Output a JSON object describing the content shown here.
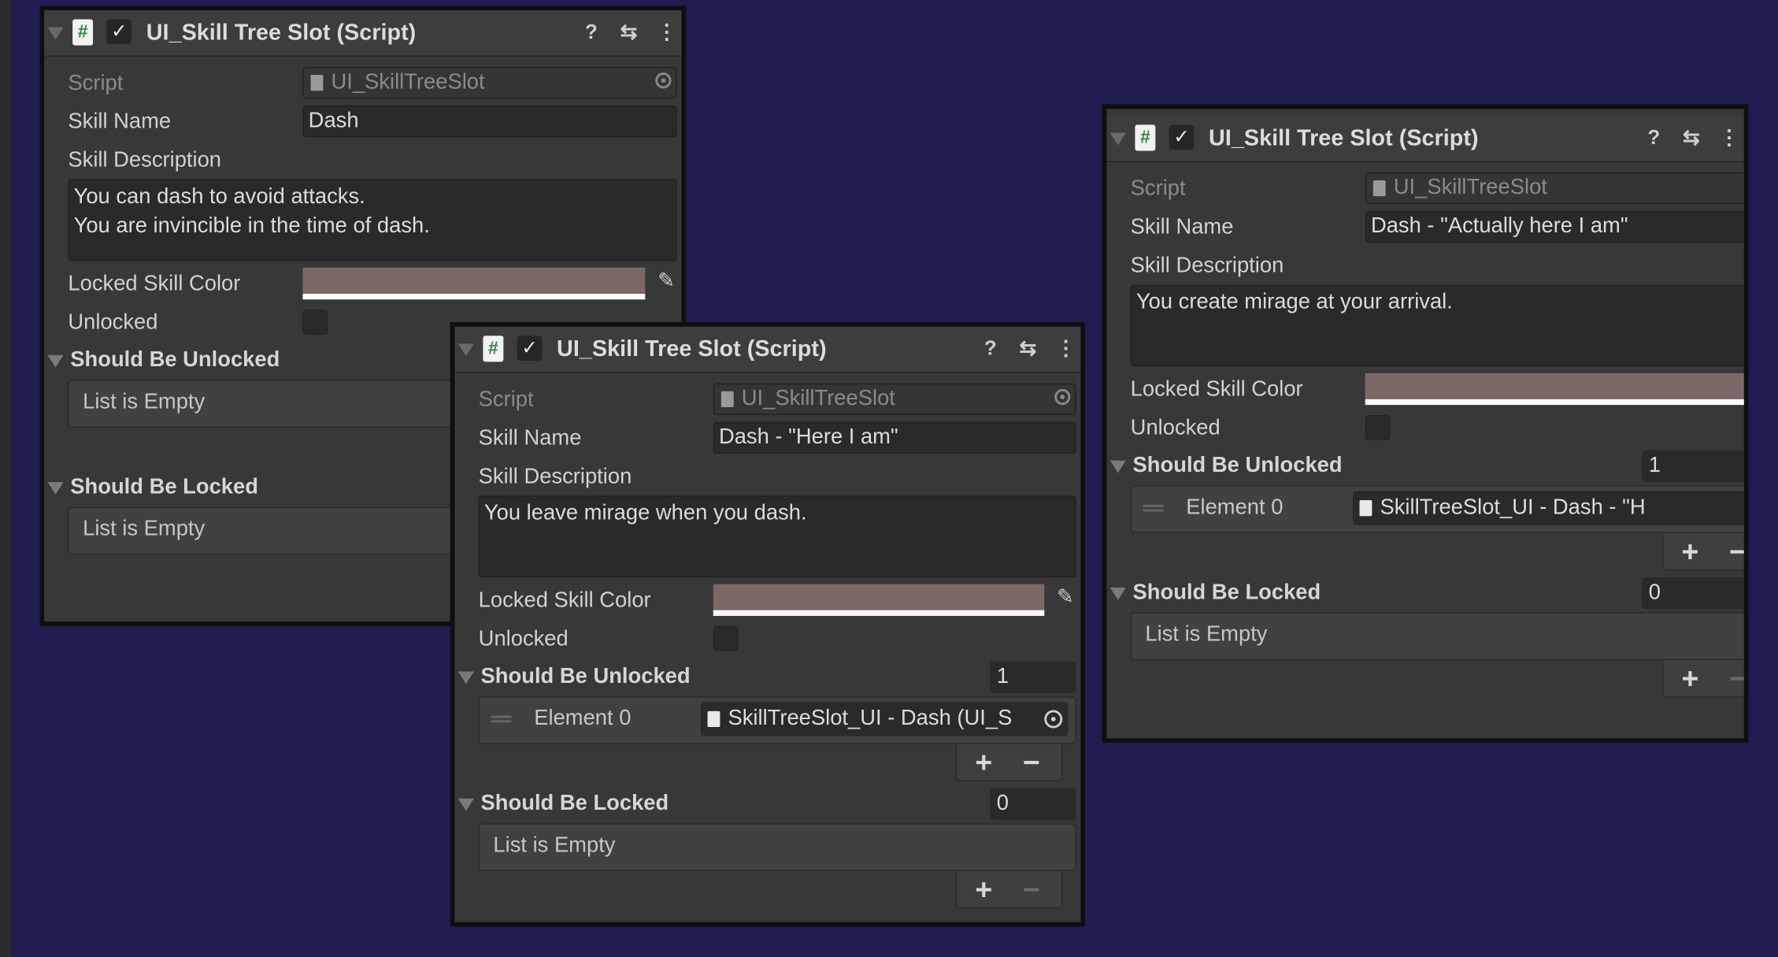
{
  "panels": [
    {
      "title": "UI_Skill Tree Slot (Script)",
      "enabled": "✓",
      "script_label": "Script",
      "script_value": "UI_SkillTreeSlot",
      "skill_name_label": "Skill Name",
      "skill_name_value": "Dash",
      "skill_description_label": "Skill Description",
      "skill_description_value": "You can dash to avoid attacks.\nYou are invincible in the time of dash.",
      "locked_color_label": "Locked Skill Color",
      "locked_color": "#7d6868",
      "unlocked_label": "Unlocked",
      "unlocked": false,
      "should_be_unlocked": {
        "label": "Should Be Unlocked",
        "empty_text": "List is Empty"
      },
      "should_be_locked": {
        "label": "Should Be Locked",
        "empty_text": "List is Empty"
      }
    },
    {
      "title": "UI_Skill Tree Slot (Script)",
      "enabled": "✓",
      "script_label": "Script",
      "script_value": "UI_SkillTreeSlot",
      "skill_name_label": "Skill Name",
      "skill_name_value": "Dash - \"Here I am\"",
      "skill_description_label": "Skill Description",
      "skill_description_value": "You leave mirage when you dash.",
      "locked_color_label": "Locked Skill Color",
      "locked_color": "#7d6868",
      "unlocked_label": "Unlocked",
      "unlocked": false,
      "should_be_unlocked": {
        "label": "Should Be Unlocked",
        "count": "1",
        "elements": [
          {
            "label": "Element 0",
            "value": "SkillTreeSlot_UI - Dash (UI_S"
          }
        ],
        "add": "+",
        "remove": "−"
      },
      "should_be_locked": {
        "label": "Should Be Locked",
        "count": "0",
        "empty_text": "List is Empty",
        "add": "+",
        "remove": "−"
      }
    },
    {
      "title": "UI_Skill Tree Slot (Script)",
      "enabled": "✓",
      "script_label": "Script",
      "script_value": "UI_SkillTreeSlot",
      "skill_name_label": "Skill Name",
      "skill_name_value": "Dash - \"Actually here I am\"",
      "skill_description_label": "Skill Description",
      "skill_description_value": "You create mirage at your arrival.",
      "locked_color_label": "Locked Skill Color",
      "locked_color": "#7d6868",
      "unlocked_label": "Unlocked",
      "unlocked": false,
      "should_be_unlocked": {
        "label": "Should Be Unlocked",
        "count": "1",
        "elements": [
          {
            "label": "Element 0",
            "value": "SkillTreeSlot_UI - Dash - \"H"
          }
        ],
        "add": "+",
        "remove": "−"
      },
      "should_be_locked": {
        "label": "Should Be Locked",
        "count": "0",
        "empty_text": "List is Empty",
        "add": "+",
        "remove": "−"
      }
    }
  ],
  "icons": {
    "help": "?",
    "presets": "⇆",
    "menu": "⋮",
    "picker": "✎"
  }
}
